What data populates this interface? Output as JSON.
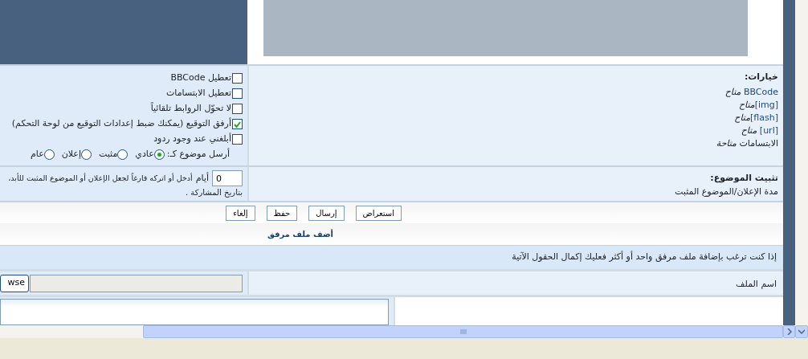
{
  "options": {
    "heading": "خيارات:",
    "rules": [
      {
        "tag": "BBCode",
        "text": " *متاح*"
      },
      {
        "tag": "[img]",
        "text": "*متاح*"
      },
      {
        "tag": "[flash]",
        "text": "*متاح*"
      },
      {
        "tag": "[url]",
        "text": " *متاح*"
      },
      {
        "text": "الابتسامات *متاحة*"
      }
    ],
    "checkboxes": [
      {
        "label": "تعطيل BBCode",
        "checked": false
      },
      {
        "label": "تعطيل الابتسامات",
        "checked": false
      },
      {
        "label": "لا تحوّل الروابط تلقائياً",
        "checked": false
      },
      {
        "label": "أرفق التوقيع (يمكنك ضبط إعدادات التوقيع من لوحة التحكم)",
        "checked": true
      },
      {
        "label": "أبلغني عند وجود ردود",
        "checked": false
      }
    ],
    "post_as_label": "أرسل موضوع كـ:",
    "post_types": [
      {
        "label": "عادي",
        "selected": true
      },
      {
        "label": "مثبت",
        "selected": false
      },
      {
        "label": "إعلان",
        "selected": false
      },
      {
        "label": "عام",
        "selected": false
      }
    ]
  },
  "sticky": {
    "heading": "تثبيت الموضوع:",
    "subtitle": "مدة الإعلان/الموضوع المثبت",
    "days_value": "0",
    "days_unit": "أيام",
    "hint_line_1": "أدخل أو اتركه فارغاً لجعل الإعلان أو الموضوع المثبت للأبد،",
    "hint_line_2": "بتاريخ المشاركة ."
  },
  "buttons": [
    "استعراض",
    "إرسال",
    "حفظ",
    "إلغاء"
  ],
  "attachment": {
    "title": "أضف ملف مرفق",
    "info": "إذا كنت ترغب بإضافة ملف مرفق واحد أو أكثر فعليك إكمال الحقول الآتية",
    "filename_label": "اسم الملف",
    "browse_button": "wse"
  }
}
